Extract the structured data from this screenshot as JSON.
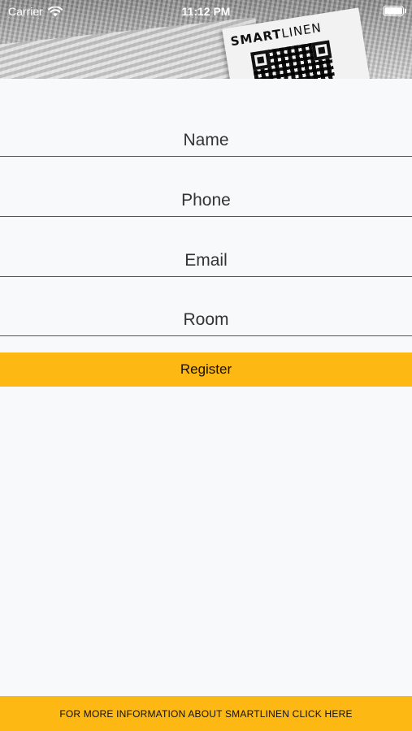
{
  "status_bar": {
    "carrier": "Carrier",
    "time": "11:12 PM",
    "wifi_icon": "wifi-icon",
    "battery_icon": "battery-icon"
  },
  "header": {
    "brand_bold": "SMART",
    "brand_light": "LINEN"
  },
  "form": {
    "name_placeholder": "Name",
    "phone_placeholder": "Phone",
    "email_placeholder": "Email",
    "room_placeholder": "Room"
  },
  "register_label": "Register",
  "footer_label": "FOR MORE INFORMATION ABOUT SMARTLINEN CLICK HERE",
  "colors": {
    "accent": "#fdb813",
    "background": "#f8f9fb"
  }
}
